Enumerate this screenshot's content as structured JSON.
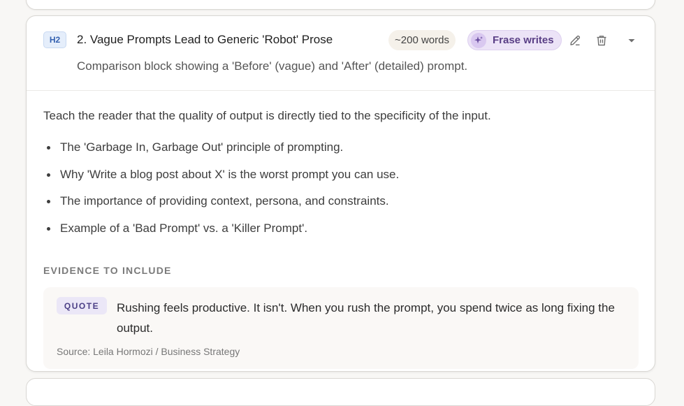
{
  "section": {
    "level": "H2",
    "title": "2. Vague Prompts Lead to Generic 'Robot' Prose",
    "description": "Comparison block showing a 'Before' (vague) and 'After' (detailed) prompt.",
    "word_count": "~200 words",
    "writer_label": "Frase writes",
    "writer_icon": "sparkle-icon",
    "actions": [
      "edit-icon",
      "trash-icon",
      "caret-down-icon"
    ]
  },
  "body": {
    "intro": "Teach the reader that the quality of output is directly tied to the specificity of the input.",
    "bullets": [
      "The 'Garbage In, Garbage Out' principle of prompting.",
      "Why 'Write a blog post about X' is the worst prompt you can use.",
      "The importance of providing context, persona, and constraints.",
      "Example of a 'Bad Prompt' vs. a 'Killer Prompt'."
    ],
    "evidence_heading": "EVIDENCE TO INCLUDE",
    "evidence": {
      "type_label": "QUOTE",
      "text": "Rushing feels productive. It isn't. When you rush the prompt, you spend twice as long fixing the output.",
      "source": "Source: Leila Hormozi / Business Strategy"
    }
  },
  "colors": {
    "badge_blue": "#3461b0",
    "frase_purple": "#5a3f86",
    "page_bg": "#f8f7f5"
  }
}
